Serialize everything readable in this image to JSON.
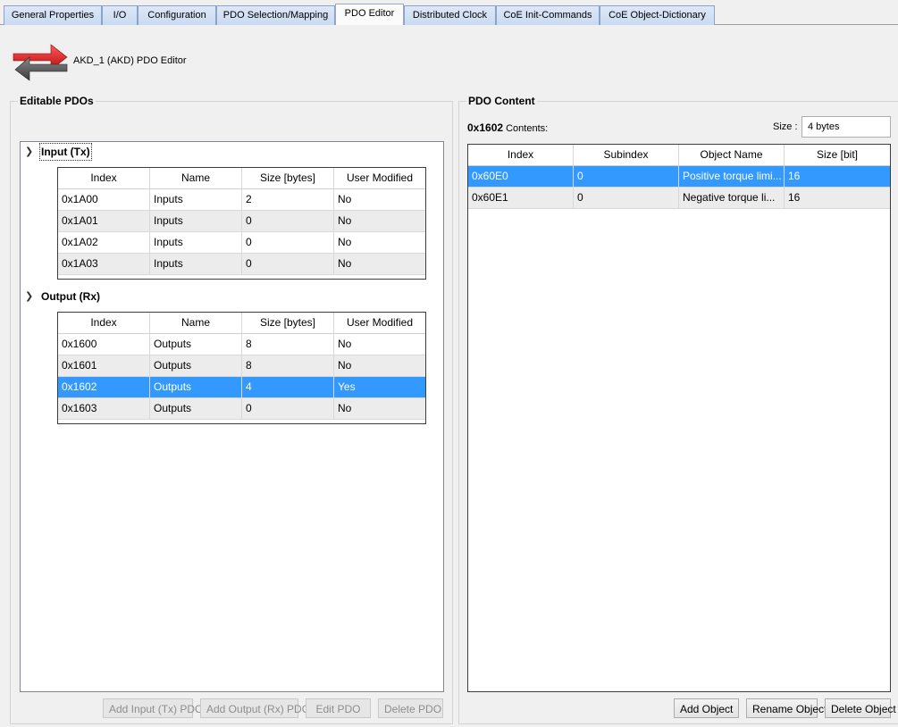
{
  "tabs": [
    {
      "label": "General Properties"
    },
    {
      "label": "I/O"
    },
    {
      "label": "Configuration"
    },
    {
      "label": "PDO Selection/Mapping"
    },
    {
      "label": "PDO Editor"
    },
    {
      "label": "Distributed Clock"
    },
    {
      "label": "CoE Init-Commands"
    },
    {
      "label": "CoE Object-Dictionary"
    }
  ],
  "active_tab": "PDO Editor",
  "header": {
    "title": "AKD_1 (AKD) PDO Editor"
  },
  "colors": {
    "selection": "#3399ff",
    "icon_red": "#d92020",
    "icon_gray": "#5a5a5a"
  },
  "editable": {
    "title": "Editable PDOs",
    "columns": [
      "Index",
      "Name",
      "Size [bytes]",
      "User Modified"
    ],
    "input": {
      "label": "Input (Tx)",
      "rows": [
        [
          "0x1A00",
          "Inputs",
          "2",
          "No"
        ],
        [
          "0x1A01",
          "Inputs",
          "0",
          "No"
        ],
        [
          "0x1A02",
          "Inputs",
          "0",
          "No"
        ],
        [
          "0x1A03",
          "Inputs",
          "0",
          "No"
        ]
      ]
    },
    "output": {
      "label": "Output (Rx)",
      "rows": [
        [
          "0x1600",
          "Outputs",
          "8",
          "No"
        ],
        [
          "0x1601",
          "Outputs",
          "8",
          "No"
        ],
        [
          "0x1602",
          "Outputs",
          "4",
          "Yes"
        ],
        [
          "0x1603",
          "Outputs",
          "0",
          "No"
        ]
      ],
      "selected_row": 2
    },
    "buttons": {
      "add_input": "Add Input (Tx) PDO",
      "add_output": "Add Output (Rx) PDO",
      "edit": "Edit PDO",
      "delete": "Delete PDO"
    }
  },
  "content": {
    "title": "PDO Content",
    "pdo_index": "0x1602",
    "contents_suffix": " Contents:",
    "size_label": "Size :",
    "size_value": "4 bytes",
    "columns": [
      "Index",
      "Subindex",
      "Object Name",
      "Size [bit]"
    ],
    "rows": [
      [
        "0x60E0",
        "0",
        "Positive torque limi...",
        "16"
      ],
      [
        "0x60E1",
        "0",
        "Negative torque li...",
        "16"
      ]
    ],
    "selected_row": 0,
    "buttons": {
      "add": "Add Object",
      "rename": "Rename Object",
      "delete": "Delete Object"
    }
  }
}
